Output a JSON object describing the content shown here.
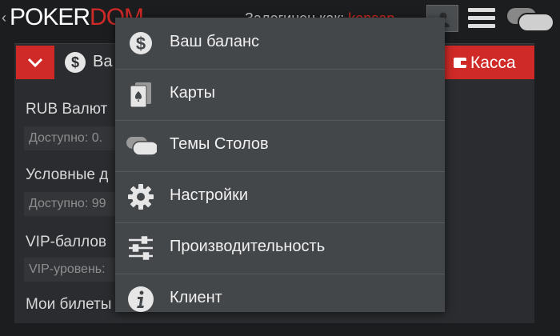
{
  "header": {
    "back_glyph": "‹",
    "logo_part1": "POKER",
    "logo_part2": "DOM",
    "login_prefix": "Залогинен как:",
    "username": "kopsap",
    "icons": [
      "avatar-icon",
      "hamburger-menu-icon",
      "tables-icon"
    ]
  },
  "panel": {
    "balance_label": "Ва",
    "kassa_label": "Касса",
    "rows": [
      {
        "title": "RUB Валют",
        "sub": "Доступно: 0."
      },
      {
        "title": "Условные д",
        "sub": "Доступно: 99"
      },
      {
        "title": "VIP-баллов",
        "sub": "VIP-уровень:"
      },
      {
        "title": "Мои билеты",
        "sub": ""
      }
    ]
  },
  "dropdown": {
    "items": [
      {
        "label": "Ваш баланс",
        "icon": "dollar-coin-icon"
      },
      {
        "label": "Карты",
        "icon": "cards-icon"
      },
      {
        "label": "Темы Столов",
        "icon": "table-themes-icon"
      },
      {
        "label": "Настройки",
        "icon": "gear-icon"
      },
      {
        "label": "Производительность",
        "icon": "sliders-icon"
      },
      {
        "label": "Клиент",
        "icon": "info-icon"
      }
    ]
  },
  "colors": {
    "accent_red": "#cf2a27",
    "menu_bg": "#44474a",
    "page_bg": "#1b1d1f"
  }
}
